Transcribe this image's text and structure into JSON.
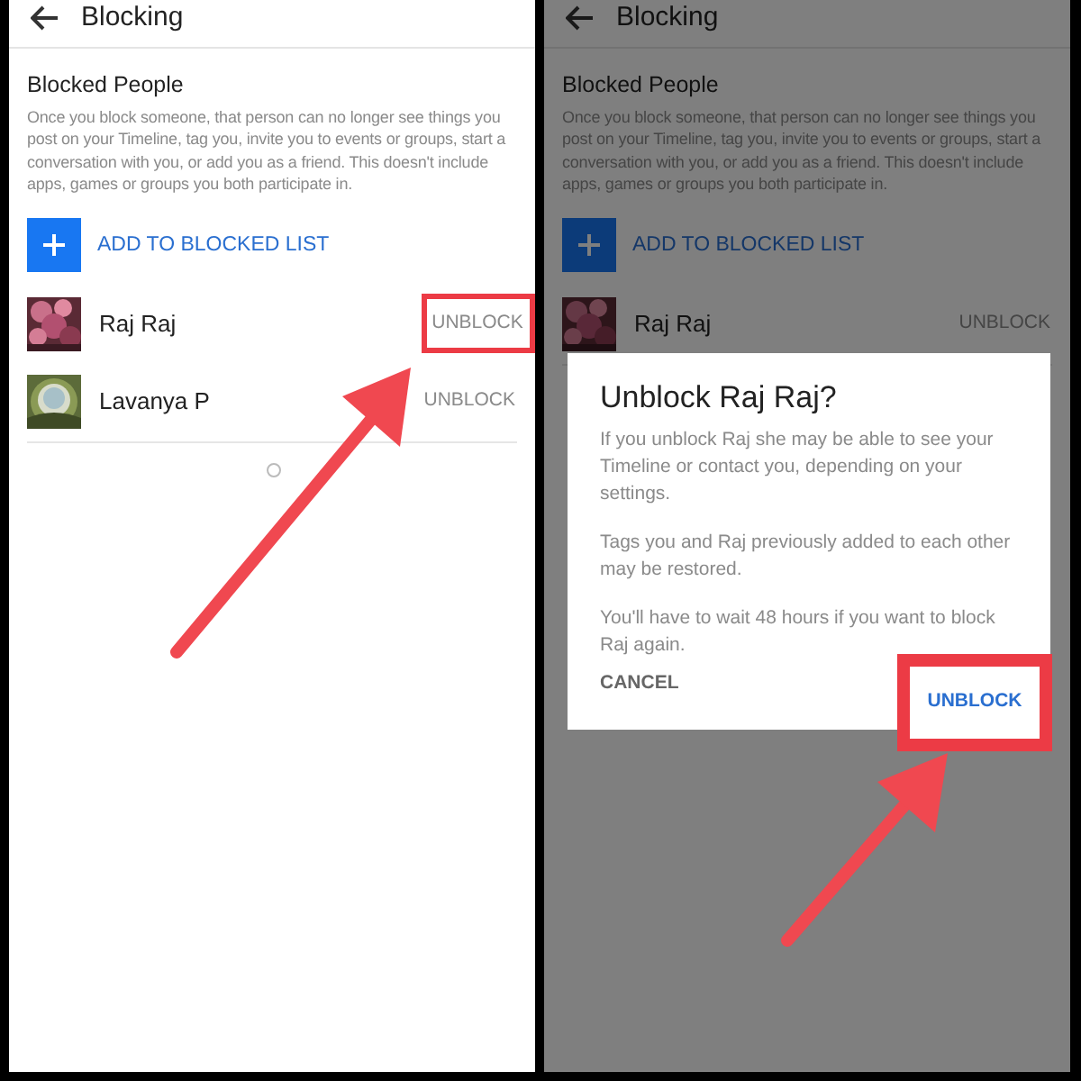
{
  "screens": [
    {
      "header_title": "Blocking",
      "section_title": "Blocked People",
      "description": "Once you block someone, that person can no longer see things you post on your Timeline, tag you, invite you to events or groups, start a conversation with you, or add you as a friend. This doesn't include apps, games or groups you both participate in.",
      "add_button": "ADD TO BLOCKED LIST",
      "people": [
        {
          "name": "Raj Raj",
          "action": "UNBLOCK",
          "highlighted": true
        },
        {
          "name": "Lavanya P",
          "action": "UNBLOCK",
          "highlighted": false
        }
      ],
      "loading": true,
      "dimmed": false
    },
    {
      "header_title": "Blocking",
      "section_title": "Blocked People",
      "description": "Once you block someone, that person can no longer see things you post on your Timeline, tag you, invite you to events or groups, start a conversation with you, or add you as a friend. This doesn't include apps, games or groups you both participate in.",
      "add_button": "ADD TO BLOCKED LIST",
      "people": [
        {
          "name": "Raj Raj",
          "action": "UNBLOCK",
          "highlighted": false
        }
      ],
      "loading": false,
      "dimmed": true,
      "dialog": {
        "title": "Unblock Raj Raj?",
        "paragraphs": [
          "If you unblock Raj she may be able to see your Timeline or contact you, depending on your settings.",
          "Tags you and Raj previously added to each other may be restored.",
          "You'll have to wait 48 hours if you want to block Raj again."
        ],
        "cancel": "CANCEL",
        "confirm": "UNBLOCK",
        "confirm_highlighted": true
      }
    }
  ]
}
